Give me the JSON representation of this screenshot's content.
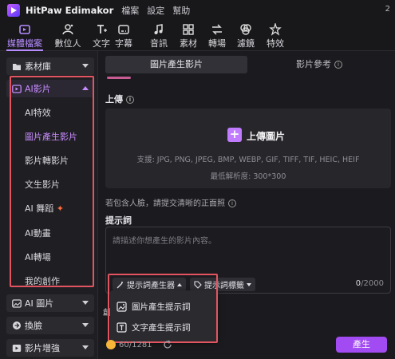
{
  "app": {
    "name": "HitPaw Edimakor",
    "badge": "2"
  },
  "menu": [
    "檔案",
    "設定",
    "幫助"
  ],
  "toolbar": {
    "tools": [
      {
        "label": "媒體檔案",
        "icon": "media-files-icon",
        "active": true
      },
      {
        "label": "數位人",
        "icon": "digital-human-icon"
      },
      {
        "label": "文字",
        "icon": "text-icon"
      },
      {
        "label": "字幕",
        "icon": "subtitle-icon"
      },
      {
        "label": "音訊",
        "icon": "audio-icon"
      },
      {
        "label": "素材",
        "icon": "materials-icon"
      },
      {
        "label": "轉場",
        "icon": "transition-icon"
      },
      {
        "label": "濾鏡",
        "icon": "filter-icon"
      },
      {
        "label": "特效",
        "icon": "effects-icon"
      }
    ]
  },
  "sidebar": {
    "library": "素材庫",
    "ai_video": "AI影片",
    "ai_video_items": [
      "AI特效",
      "圖片產生影片",
      "影片轉影片",
      "文生影片",
      "AI 舞蹈",
      "AI動畫",
      "AI轉場",
      "我的創作"
    ],
    "active_item": "圖片產生影片",
    "ai_image": "AI 圖片",
    "face_swap": "換臉",
    "video_enhance": "影片增強"
  },
  "main": {
    "tabs": [
      "圖片產生影片",
      "影片參考"
    ],
    "upload_label": "上傳",
    "upload_button": "上傳圖片",
    "formats": "支援: JPG, PNG, JPEG, BMP, WEBP, GIF, TIFF, TIF, HEIC, HEIF",
    "min_resolution": "最低解析度:   300*300",
    "face_note": "若包含人臉，請提交清晰的正面照",
    "prompt_label": "提示詞",
    "prompt_placeholder": "請描述你想產生的影片內容。",
    "prompt_generator": "提示詞產生器",
    "prompt_tags": "提示詞標籤",
    "counter_current": "0",
    "counter_max": "/2000",
    "dropdown": [
      "圖片產生提示詞",
      "文字產生提示詞"
    ],
    "credits": "60/1281",
    "create_button": "產生"
  },
  "colors": {
    "accent": "#c78bff",
    "highlight_box": "#e25560",
    "create": "#a24bf2"
  }
}
